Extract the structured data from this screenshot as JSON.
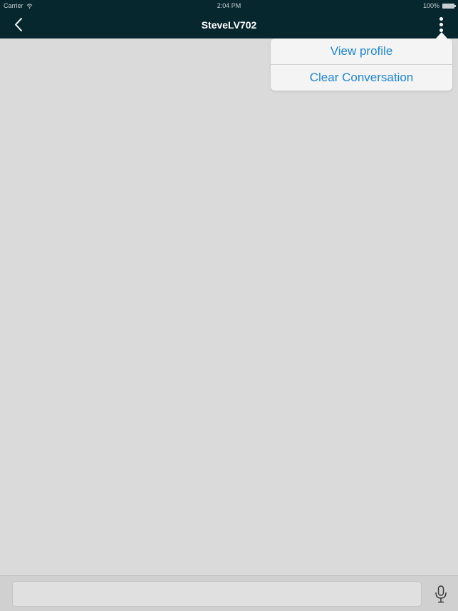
{
  "status_bar": {
    "carrier": "Carrier",
    "time": "2:04 PM",
    "battery": "100%"
  },
  "nav": {
    "title": "SteveLV702",
    "back_icon": "chevron-left-icon",
    "more_icon": "vertical-ellipsis-icon"
  },
  "menu": {
    "items": [
      {
        "label": "View profile"
      },
      {
        "label": "Clear Conversation"
      }
    ]
  },
  "compose": {
    "value": "",
    "placeholder": "",
    "mic_icon": "microphone-icon"
  },
  "colors": {
    "nav_background": "#07272f",
    "chat_background": "#dadada",
    "menu_text": "#1f86d6",
    "menu_background": "#f4f4f4"
  }
}
